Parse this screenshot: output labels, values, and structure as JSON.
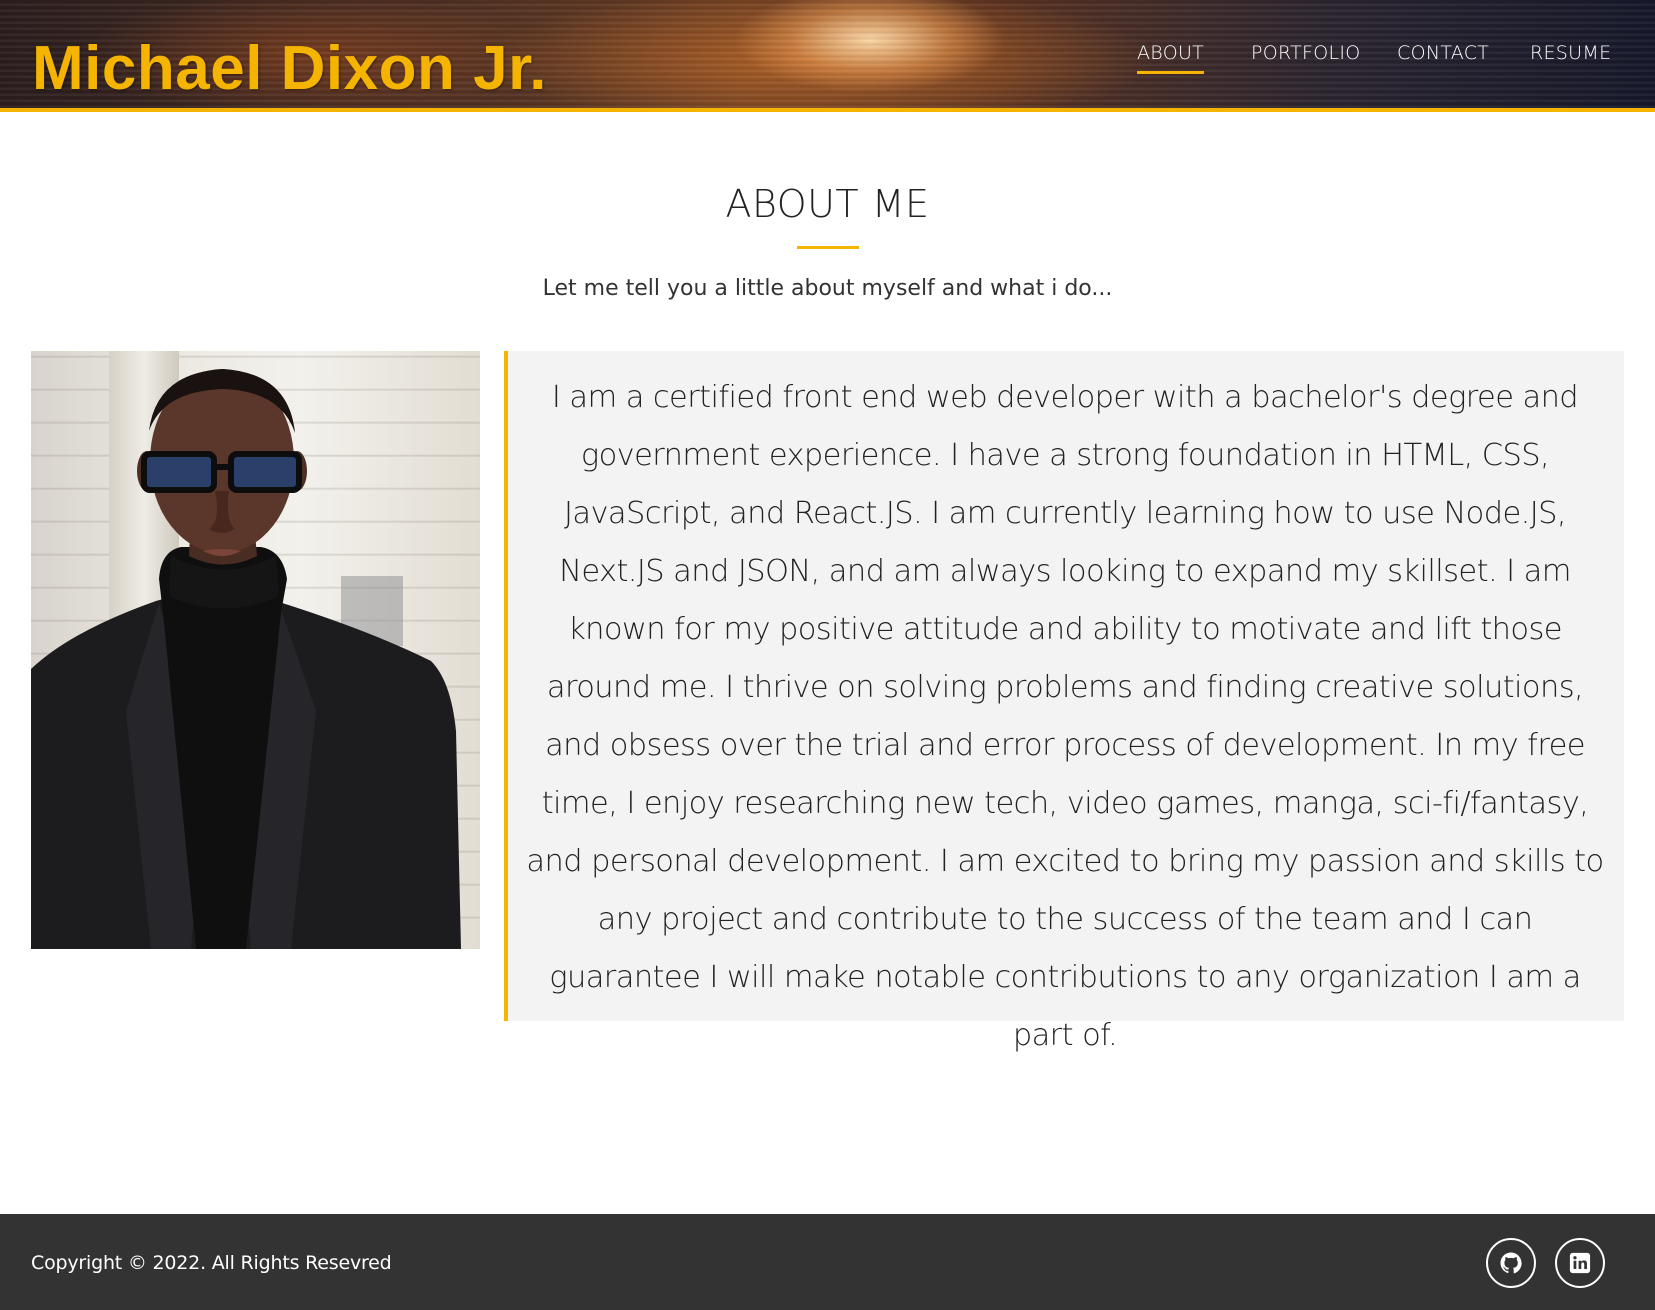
{
  "header": {
    "brand": "Michael Dixon Jr.",
    "accent_color": "#f5b400",
    "nav": [
      {
        "label": "ABOUT",
        "active": true
      },
      {
        "label": "PORTFOLIO",
        "active": false
      },
      {
        "label": "CONTACT",
        "active": false
      },
      {
        "label": "RESUME",
        "active": false
      }
    ]
  },
  "about": {
    "title": "ABOUT ME",
    "subtitle": "Let me tell you a little about myself and what i do...",
    "bio": "I am a certified front end web developer with a bachelor's degree and government experience. I have a strong foundation in HTML, CSS, JavaScript, and React.JS. I am currently learning how to use Node.JS, Next.JS and JSON, and am always looking to expand my skillset. I am known for my positive attitude and ability to motivate and lift those around me. I thrive on solving problems and finding creative solutions, and obsess over the trial and error process of development. In my free time, I enjoy researching new tech, video games, manga, sci-fi/fantasy, and personal development. I am excited to bring my passion and skills to any project and contribute to the success of the team and I can guarantee I will make notable contributions to any organization I am a part of."
  },
  "footer": {
    "copyright": "Copyright © 2022. All Rights Resevred",
    "social": [
      {
        "icon": "github-icon"
      },
      {
        "icon": "linkedin-icon"
      }
    ],
    "background": "#333333"
  }
}
